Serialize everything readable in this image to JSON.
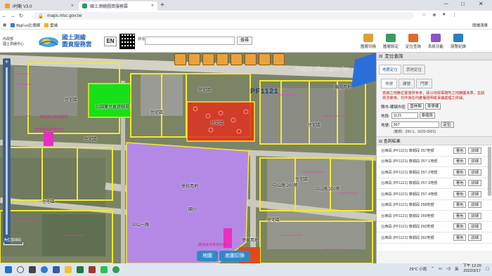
{
  "browser": {
    "tabs": [
      {
        "label": "i村動 V3.0",
        "active": false
      },
      {
        "label": "國土測繪圖資服務雲",
        "active": true
      }
    ],
    "url": "maps.nlsc.gov.tw",
    "bookmarks": [
      "BigFun比價網",
      "雲端"
    ],
    "reading_list": "閱讀清單"
  },
  "site": {
    "org_line1": "內政部",
    "org_line2": "國土測繪中心",
    "title_line1": "國土測繪",
    "title_line2": "圖資服務雲",
    "en_label": "EN",
    "search_label": "搜尋",
    "search_placeholder": "",
    "search_button": "搜尋",
    "tools": [
      "圖層切換",
      "圖層設定",
      "定位查詢",
      "系統功能",
      "瀏覽紀錄"
    ]
  },
  "map": {
    "watermark": "maps.nlsc.gov.tw",
    "section_label": "PF1121",
    "labels": [
      {
        "text": "住宅區",
        "pos": "a"
      },
      {
        "text": "住宅區",
        "pos": "b"
      },
      {
        "text": "住宅區",
        "pos": "c"
      },
      {
        "text": "住宅區",
        "pos": "d"
      },
      {
        "text": "住宅區",
        "pos": "e"
      },
      {
        "text": "住宅區",
        "pos": "f"
      },
      {
        "text": "住宅區",
        "pos": "g"
      },
      {
        "text": "住宅區",
        "pos": "h"
      },
      {
        "text": "學校用地",
        "pos": "i"
      },
      {
        "text": "中山路 200巷",
        "pos": "j"
      },
      {
        "text": "中山路 200巷",
        "pos": "k"
      },
      {
        "text": "公園兼兒童遊戲場",
        "pos": "l"
      },
      {
        "text": "廣場兼停車場用地",
        "pos": "m"
      },
      {
        "text": "廣場兼兒童遊戲場",
        "pos": "n"
      },
      {
        "text": "機關用地",
        "pos": "o"
      },
      {
        "text": "國小",
        "pos": "p"
      },
      {
        "text": "廣場兼停車場用地",
        "pos": "q"
      },
      {
        "text": "停車用地",
        "pos": "r"
      },
      {
        "text": "中山一路",
        "pos": "s"
      },
      {
        "text": "住宅區",
        "pos": "t"
      }
    ],
    "scale_text": "大立加油站",
    "buttons": [
      "地圖",
      "底圖切換"
    ]
  },
  "panel": {
    "title": "定位查詢",
    "tabs": [
      {
        "label": "地籍定位",
        "active": true
      },
      {
        "label": "其他定位",
        "active": false
      }
    ],
    "subtabs": [
      {
        "label": "地號",
        "active": true
      },
      {
        "label": "建號",
        "active": false
      },
      {
        "label": "門牌",
        "active": false
      }
    ],
    "notice": "查詢之地籍位置僅供參考，請以地政事務所之地籍圖為準，並請依法使用，勿作為任何產權證明或爭議處理之依據。",
    "county_label": "縣市-鄉鎮市區:",
    "county_value": "雲林縣",
    "town_value": "麥寮鄉",
    "section_label": "地段:",
    "section_code": "1121",
    "section_name": "泰順段",
    "landno_label": "地號:",
    "landno_value": "367",
    "locate_btn": "定位",
    "hint": "(範例：200-1、0220-0001)",
    "results_title": "查詢結果",
    "results": [
      "台西段 (PF1121) 泰順段 357地號",
      "台西段 (PF1121) 泰順段 357-1地號",
      "台西段 (PF1121) 泰順段 357-2地號",
      "台西段 (PF1121) 泰順段 357-3地號",
      "台西段 (PF1121) 泰順段 357-4地號",
      "台西段 (PF1121) 泰順段 358地號",
      "台西段 (PF1121) 泰順段 359地號",
      "台西段 (PF1121) 泰順段 360地號",
      "台西段 (PF1121) 泰順段 362地號"
    ],
    "row_btn_color": "著色",
    "row_btn_detail": "詳細"
  },
  "taskbar": {
    "weather": "29°C 小雨",
    "ime": "英",
    "time": "下午 12:20",
    "date": "2022/3/17"
  },
  "colors": {
    "school": "#b489e6",
    "park": "#18e018",
    "highlight": "#e0301e",
    "boundary": "#f2ea2a",
    "plaza": "#e82fc2",
    "accent": "#2d8ac9"
  }
}
